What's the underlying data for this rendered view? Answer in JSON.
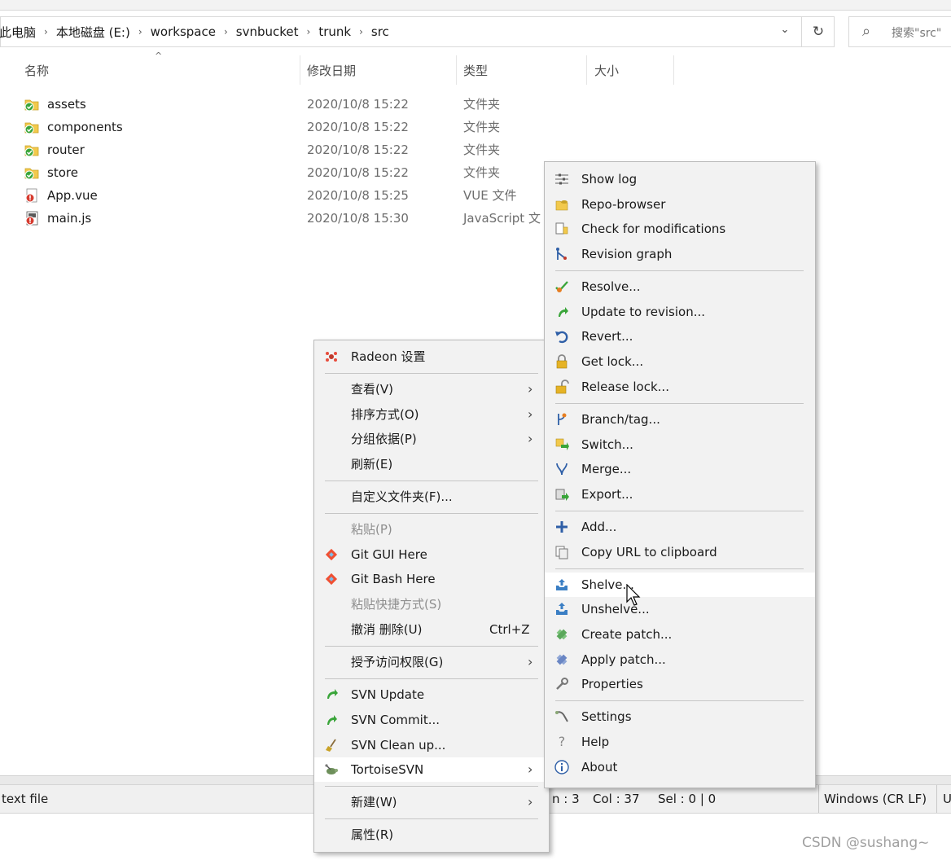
{
  "breadcrumb": {
    "items": [
      "此电脑",
      "本地磁盘 (E:)",
      "workspace",
      "svnbucket",
      "trunk",
      "src"
    ],
    "separator": "›"
  },
  "address_dropdown_glyph": "⌄",
  "refresh_glyph": "↻",
  "search": {
    "placeholder": "搜索\"src\""
  },
  "columns": {
    "name": "名称",
    "date": "修改日期",
    "type": "类型",
    "size": "大小"
  },
  "files": [
    {
      "name": "assets",
      "date": "2020/10/8 15:22",
      "type": "文件夹",
      "icon": "folder-svn-ok-icon"
    },
    {
      "name": "components",
      "date": "2020/10/8 15:22",
      "type": "文件夹",
      "icon": "folder-svn-ok-icon"
    },
    {
      "name": "router",
      "date": "2020/10/8 15:22",
      "type": "文件夹",
      "icon": "folder-svn-ok-icon"
    },
    {
      "name": "store",
      "date": "2020/10/8 15:22",
      "type": "文件夹",
      "icon": "folder-svn-ok-icon"
    },
    {
      "name": "App.vue",
      "date": "2020/10/8 15:25",
      "type": "VUE 文件",
      "icon": "vue-file-modified-icon"
    },
    {
      "name": "main.js",
      "date": "2020/10/8 15:30",
      "type": "JavaScript 文",
      "icon": "js-file-modified-icon"
    }
  ],
  "context_menu": {
    "items": [
      {
        "label": "Radeon 设置",
        "icon": "radeon-icon"
      },
      {
        "label": "查看(V)",
        "submenu": true
      },
      {
        "label": "排序方式(O)",
        "submenu": true
      },
      {
        "label": "分组依据(P)",
        "submenu": true
      },
      {
        "label": "刷新(E)"
      },
      {
        "label": "自定义文件夹(F)..."
      },
      {
        "label": "粘贴(P)",
        "disabled": true
      },
      {
        "label": "Git GUI Here",
        "icon": "git-icon"
      },
      {
        "label": "Git Bash Here",
        "icon": "git-icon"
      },
      {
        "label": "粘贴快捷方式(S)",
        "disabled": true
      },
      {
        "label": "撤消 删除(U)",
        "shortcut": "Ctrl+Z"
      },
      {
        "label": "授予访问权限(G)",
        "submenu": true
      },
      {
        "label": "SVN Update",
        "icon": "svn-update-icon"
      },
      {
        "label": "SVN Commit...",
        "icon": "svn-commit-icon"
      },
      {
        "label": "SVN Clean up...",
        "icon": "broom-icon"
      },
      {
        "label": "TortoiseSVN",
        "icon": "tortoise-icon",
        "submenu": true,
        "highlighted": true
      },
      {
        "label": "新建(W)",
        "submenu": true
      },
      {
        "label": "属性(R)"
      }
    ]
  },
  "submenu": {
    "items": [
      {
        "label": "Show log",
        "icon": "log-icon"
      },
      {
        "label": "Repo-browser",
        "icon": "repo-browser-icon"
      },
      {
        "label": "Check for modifications",
        "icon": "check-modifications-icon"
      },
      {
        "label": "Revision graph",
        "icon": "revision-graph-icon"
      },
      {
        "label": "Resolve...",
        "icon": "resolve-icon"
      },
      {
        "label": "Update to revision...",
        "icon": "update-revision-icon"
      },
      {
        "label": "Revert...",
        "icon": "revert-icon"
      },
      {
        "label": "Get lock...",
        "icon": "lock-icon"
      },
      {
        "label": "Release lock...",
        "icon": "unlock-icon"
      },
      {
        "label": "Branch/tag...",
        "icon": "branch-icon"
      },
      {
        "label": "Switch...",
        "icon": "switch-icon"
      },
      {
        "label": "Merge...",
        "icon": "merge-icon"
      },
      {
        "label": "Export...",
        "icon": "export-icon"
      },
      {
        "label": "Add...",
        "icon": "add-icon"
      },
      {
        "label": "Copy URL to clipboard",
        "icon": "copy-url-icon"
      },
      {
        "label": "Shelve...",
        "icon": "shelve-icon",
        "highlighted": true
      },
      {
        "label": "Unshelve...",
        "icon": "unshelve-icon"
      },
      {
        "label": "Create patch...",
        "icon": "create-patch-icon"
      },
      {
        "label": "Apply patch...",
        "icon": "apply-patch-icon"
      },
      {
        "label": "Properties",
        "icon": "wrench-icon"
      },
      {
        "label": "Settings",
        "icon": "settings-icon"
      },
      {
        "label": "Help",
        "icon": "help-icon"
      },
      {
        "label": "About",
        "icon": "info-icon"
      }
    ]
  },
  "statusbar": {
    "left": "text file",
    "line": "n : 3",
    "col": "Col : 37",
    "sel": "Sel : 0 | 0",
    "eol": "Windows (CR LF)",
    "enc": "U"
  },
  "watermark": "CSDN @sushang~"
}
